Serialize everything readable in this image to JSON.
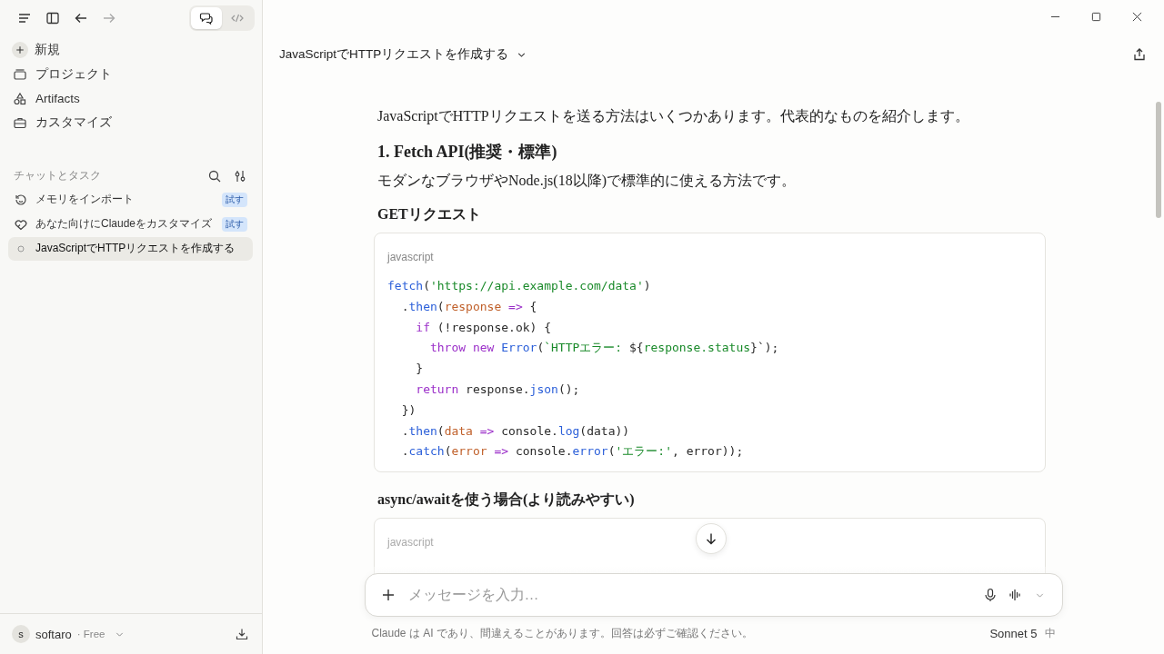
{
  "toolbar": {
    "mode_toggle": [
      {
        "kind": "chat",
        "selected": true
      },
      {
        "kind": "code",
        "selected": false
      }
    ]
  },
  "sidebar": {
    "nav": [
      {
        "kind": "new",
        "label": "新規"
      },
      {
        "kind": "project",
        "label": "プロジェクト"
      },
      {
        "kind": "artifacts",
        "label": "Artifacts"
      },
      {
        "kind": "customize",
        "label": "カスタマイズ"
      }
    ],
    "section_title": "チャットとタスク",
    "chats": [
      {
        "kind": "memory",
        "label": "メモリをインポート",
        "badge": "試す",
        "selected": false
      },
      {
        "kind": "personalize",
        "label": "あなた向けにClaudeをカスタマイズ",
        "badge": "試す",
        "selected": false
      },
      {
        "kind": "chat",
        "label": "JavaScriptでHTTPリクエストを作成する",
        "selected": true
      }
    ],
    "user": {
      "initial": "s",
      "name": "softaro",
      "plan": "· Free"
    }
  },
  "conversation": {
    "title": "JavaScriptでHTTPリクエストを作成する",
    "blocks": [
      {
        "kind": "paragraph",
        "text": "JavaScriptでHTTPリクエストを送る方法はいくつかあります。代表的なものを紹介します。"
      },
      {
        "kind": "heading",
        "text": "1. Fetch API(推奨・標準)"
      },
      {
        "kind": "paragraph",
        "text": "モダンなブラウザやNode.js(18以降)で標準的に使える方法です。"
      },
      {
        "kind": "subheading",
        "text": "GETリクエスト"
      },
      {
        "kind": "code",
        "language": "javascript",
        "lines": [
          [
            {
              "kind": "function",
              "text": "fetch"
            },
            {
              "kind": "plain",
              "text": "("
            },
            {
              "kind": "string",
              "text": "'https://api.example.com/data'"
            },
            {
              "kind": "plain",
              "text": ")"
            }
          ],
          [
            {
              "kind": "plain",
              "text": "  ."
            },
            {
              "kind": "function",
              "text": "then"
            },
            {
              "kind": "plain",
              "text": "("
            },
            {
              "kind": "param",
              "text": "response"
            },
            {
              "kind": "keyword",
              "text": " => "
            },
            {
              "kind": "plain",
              "text": "{"
            }
          ],
          [
            {
              "kind": "keyword",
              "text": "    if"
            },
            {
              "kind": "plain",
              "text": " (!response.ok) {"
            }
          ],
          [
            {
              "kind": "keyword",
              "text": "      throw new "
            },
            {
              "kind": "function",
              "text": "Error"
            },
            {
              "kind": "plain",
              "text": "("
            },
            {
              "kind": "string",
              "text": "`HTTPエラー: "
            },
            {
              "kind": "plain",
              "text": "${"
            },
            {
              "kind": "string",
              "text": "response.status"
            },
            {
              "kind": "plain",
              "text": "}`);"
            }
          ],
          [
            {
              "kind": "plain",
              "text": "    }"
            }
          ],
          [
            {
              "kind": "keyword",
              "text": "    return"
            },
            {
              "kind": "plain",
              "text": " response."
            },
            {
              "kind": "function",
              "text": "json"
            },
            {
              "kind": "plain",
              "text": "();"
            }
          ],
          [
            {
              "kind": "plain",
              "text": "  })"
            }
          ],
          [
            {
              "kind": "plain",
              "text": "  ."
            },
            {
              "kind": "function",
              "text": "then"
            },
            {
              "kind": "plain",
              "text": "("
            },
            {
              "kind": "param",
              "text": "data"
            },
            {
              "kind": "keyword",
              "text": " => "
            },
            {
              "kind": "plain",
              "text": "console."
            },
            {
              "kind": "function",
              "text": "log"
            },
            {
              "kind": "plain",
              "text": "(data))"
            }
          ],
          [
            {
              "kind": "plain",
              "text": "  ."
            },
            {
              "kind": "function",
              "text": "catch"
            },
            {
              "kind": "plain",
              "text": "("
            },
            {
              "kind": "param",
              "text": "error"
            },
            {
              "kind": "keyword",
              "text": " => "
            },
            {
              "kind": "plain",
              "text": "console."
            },
            {
              "kind": "function",
              "text": "error"
            },
            {
              "kind": "plain",
              "text": "("
            },
            {
              "kind": "string",
              "text": "'エラー:'"
            },
            {
              "kind": "plain",
              "text": ", error));"
            }
          ]
        ]
      },
      {
        "kind": "subheading",
        "text": "async/awaitを使う場合(より読みやすい)"
      },
      {
        "kind": "code",
        "language": "javascript"
      }
    ]
  },
  "composer": {
    "placeholder": "メッセージを入力…"
  },
  "footer": {
    "disclaimer": "Claude は AI であり、間違えることがあります。回答は必ずご確認ください。",
    "model": "Sonnet 5",
    "effort": "中"
  }
}
